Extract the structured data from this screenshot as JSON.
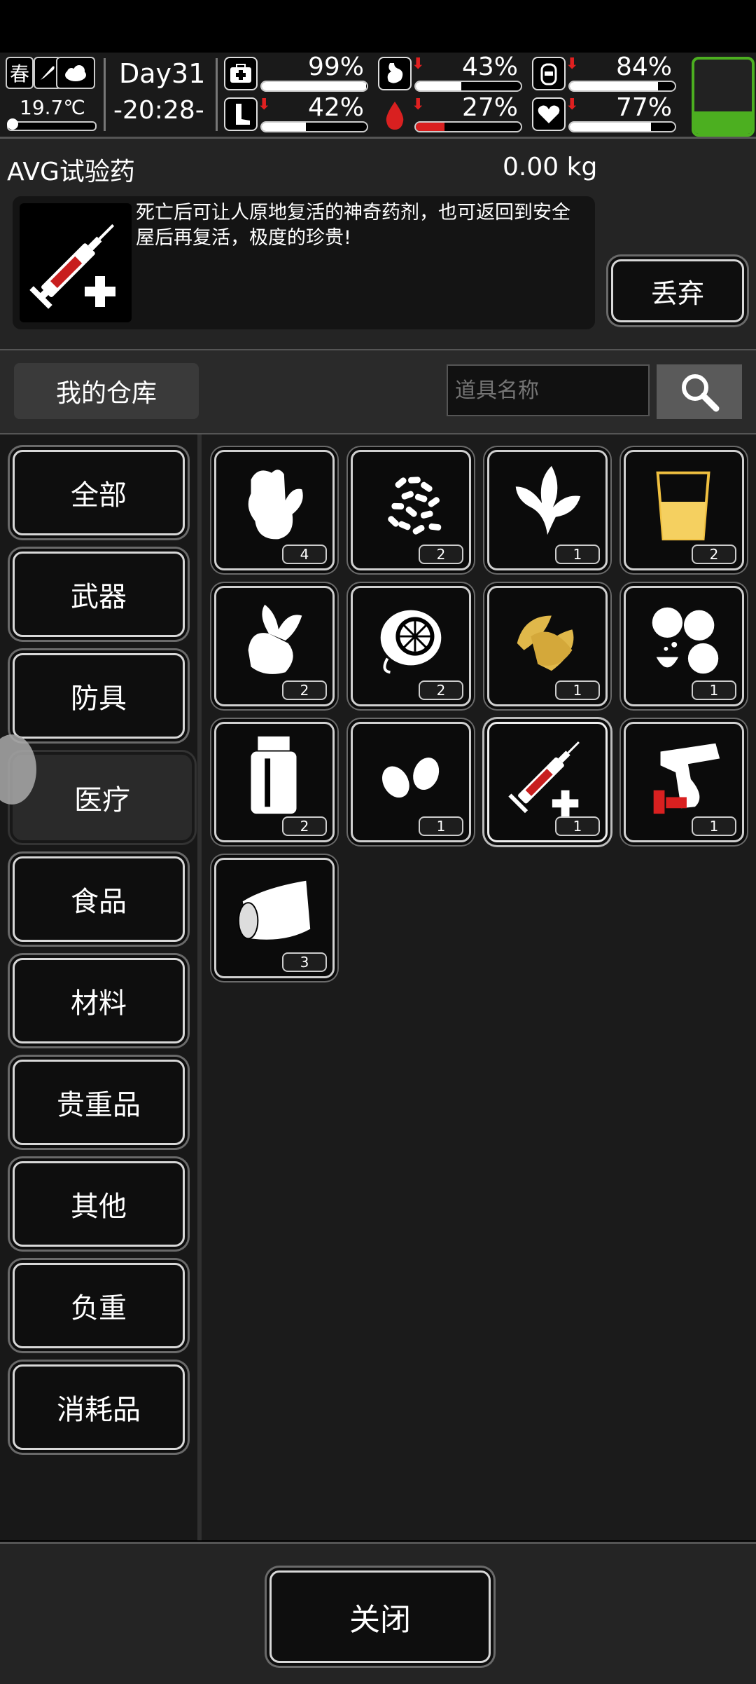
{
  "status": {
    "season": "春",
    "temperature": "19.7℃",
    "day": "Day31",
    "time": "-20:28-",
    "stats": [
      {
        "name": "health",
        "value": "99%",
        "fill": 0.99,
        "falling": false
      },
      {
        "name": "hunger",
        "value": "43%",
        "fill": 0.43,
        "falling": true
      },
      {
        "name": "thirst",
        "value": "84%",
        "fill": 0.84,
        "falling": true
      },
      {
        "name": "stamina",
        "value": "42%",
        "fill": 0.42,
        "falling": true
      },
      {
        "name": "blood",
        "value": "27%",
        "fill": 0.27,
        "falling": true
      },
      {
        "name": "mood",
        "value": "77%",
        "fill": 0.77,
        "falling": true
      }
    ],
    "battery_level": 0.3,
    "colors": {
      "battery": "#4caf20",
      "blood_bar": "#d92020",
      "warning_arrow": "#e02020"
    }
  },
  "detail": {
    "item_name": "AVG试验药",
    "weight": "0.00 kg",
    "description": "死亡后可让人原地复活的神奇药剂，也可返回到安全屋后再复活，极度的珍贵!",
    "discard_label": "丢弃",
    "icon": "syringe-plus-icon"
  },
  "storage": {
    "title": "我的仓库",
    "search_placeholder": "道具名称"
  },
  "categories": [
    {
      "label": "全部",
      "selected": false
    },
    {
      "label": "武器",
      "selected": false
    },
    {
      "label": "防具",
      "selected": false
    },
    {
      "label": "医疗",
      "selected": true
    },
    {
      "label": "食品",
      "selected": false
    },
    {
      "label": "材料",
      "selected": false
    },
    {
      "label": "贵重品",
      "selected": false
    },
    {
      "label": "其他",
      "selected": false
    },
    {
      "label": "负重",
      "selected": false
    },
    {
      "label": "消耗品",
      "selected": false
    }
  ],
  "items": [
    {
      "icon": "ginger-icon",
      "count": "4",
      "selected": false
    },
    {
      "icon": "pills-icon",
      "count": "2",
      "selected": false
    },
    {
      "icon": "herb-leaves-icon",
      "count": "1",
      "selected": false
    },
    {
      "icon": "juice-cup-icon",
      "count": "2",
      "selected": false
    },
    {
      "icon": "root-vegetable-icon",
      "count": "2",
      "selected": false
    },
    {
      "icon": "citrus-slice-icon",
      "count": "2",
      "selected": false
    },
    {
      "icon": "tobacco-leaves-icon",
      "count": "1",
      "selected": false
    },
    {
      "icon": "tablets-icon",
      "count": "1",
      "selected": false
    },
    {
      "icon": "medicine-bottle-icon",
      "count": "2",
      "selected": false
    },
    {
      "icon": "seeds-icon",
      "count": "1",
      "selected": false
    },
    {
      "icon": "syringe-plus-icon",
      "count": "1",
      "selected": true
    },
    {
      "icon": "flare-gun-icon",
      "count": "1",
      "selected": false
    },
    {
      "icon": "bandage-icon",
      "count": "3",
      "selected": false
    }
  ],
  "footer": {
    "close_label": "关闭"
  }
}
